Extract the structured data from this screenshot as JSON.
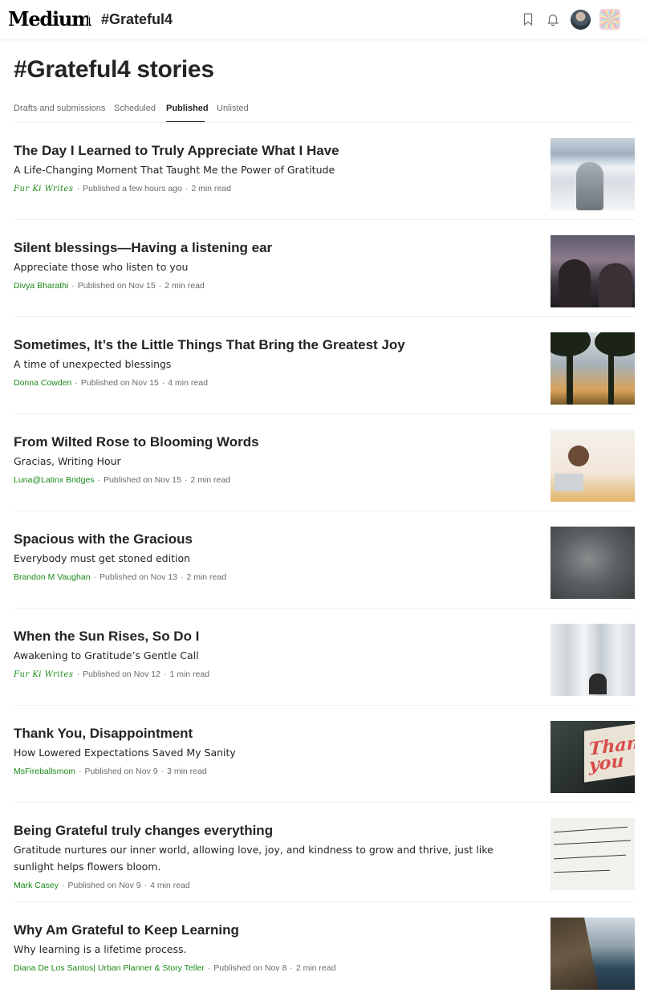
{
  "header": {
    "logo": "Medium",
    "publication": "#Grateful4",
    "icons": [
      "bookmark-icon",
      "bell-icon"
    ]
  },
  "page": {
    "title": "#Grateful4 stories"
  },
  "tabs": [
    {
      "label": "Drafts and submissions"
    },
    {
      "label": "Scheduled"
    },
    {
      "label": "Published"
    },
    {
      "label": "Unlisted"
    }
  ],
  "active_tab": "Published",
  "colors": {
    "author_green": "#1a8917",
    "text": "#242424",
    "muted": "#6b6b6b"
  },
  "stories": [
    {
      "title": "The Day I Learned to Truly Appreciate What I Have",
      "subtitle": "A Life-Changing Moment That Taught Me the Power of Gratitude",
      "author": "Fur Ki Writes",
      "published": "Published a few hours ago",
      "read_time": "2 min read"
    },
    {
      "title": "Silent blessings—Having a listening ear",
      "subtitle": "Appreciate those who listen to you",
      "author": "Divya Bharathi",
      "published": "Published on Nov 15",
      "read_time": "2 min read"
    },
    {
      "title": "Sometimes, It’s the Little Things That Bring the Greatest Joy",
      "subtitle": "A time of unexpected blessings",
      "author": "Donna Cowden",
      "published": "Published on Nov 15",
      "read_time": "4 min read"
    },
    {
      "title": "From Wilted Rose to Blooming Words",
      "subtitle": "Gracias, Writing Hour",
      "author": "Luna@Latinx Bridges",
      "published": "Published on Nov 15",
      "read_time": "2 min read"
    },
    {
      "title": "Spacious with the Gracious",
      "subtitle": "Everybody must get stoned edition",
      "author": "Brandon M Vaughan",
      "published": "Published on Nov 13",
      "read_time": "2 min read"
    },
    {
      "title": "When the Sun Rises, So Do I",
      "subtitle": "Awakening to Gratitude’s Gentle Call",
      "author": "Fur Ki Writes",
      "published": "Published on Nov 12",
      "read_time": "1 min read"
    },
    {
      "title": "Thank You, Disappointment",
      "subtitle": "How Lowered Expectations Saved My Sanity",
      "author": "MsFireballsmom",
      "published": "Published on Nov 9",
      "read_time": "3 min read"
    },
    {
      "title": "Being Grateful truly changes everything",
      "subtitle": "Gratitude nurtures our inner world, allowing love, joy, and kindness to grow and thrive, just like sunlight helps flowers bloom.",
      "author": "Mark Casey",
      "published": "Published on Nov 9",
      "read_time": "4 min read"
    },
    {
      "title": "Why Am Grateful to Keep Learning",
      "subtitle": "Why learning is a lifetime process.",
      "author": "Diana De Los Santos| Urban Planner & Story Teller",
      "published": "Published on Nov 8",
      "read_time": "2 min read"
    }
  ],
  "thumb_sign_text": "Thank you"
}
